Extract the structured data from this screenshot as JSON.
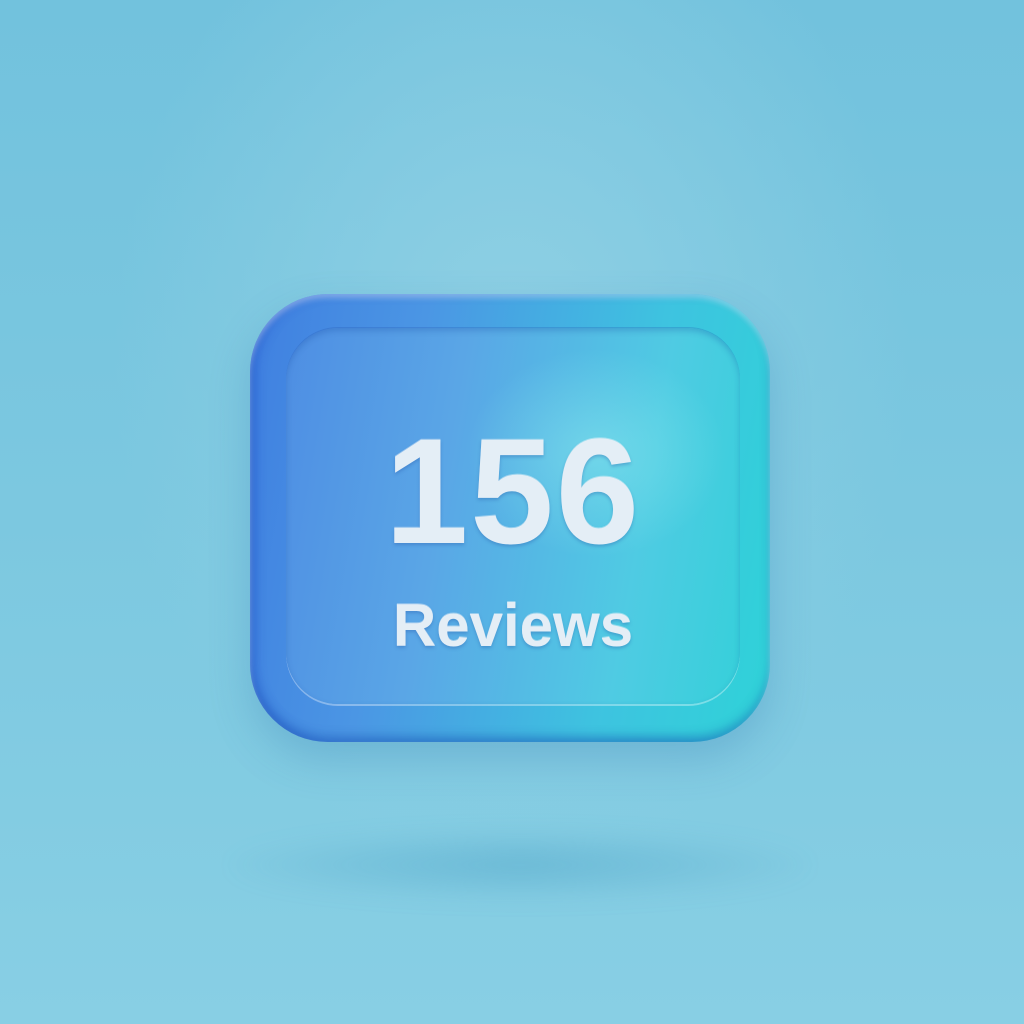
{
  "badge": {
    "count": "156",
    "label": "Reviews"
  },
  "colors": {
    "background": "#7cc8e0",
    "card_gradient_start": "#3f7fe0",
    "card_gradient_end": "#2fd3d8",
    "text": "#e4eef6"
  }
}
